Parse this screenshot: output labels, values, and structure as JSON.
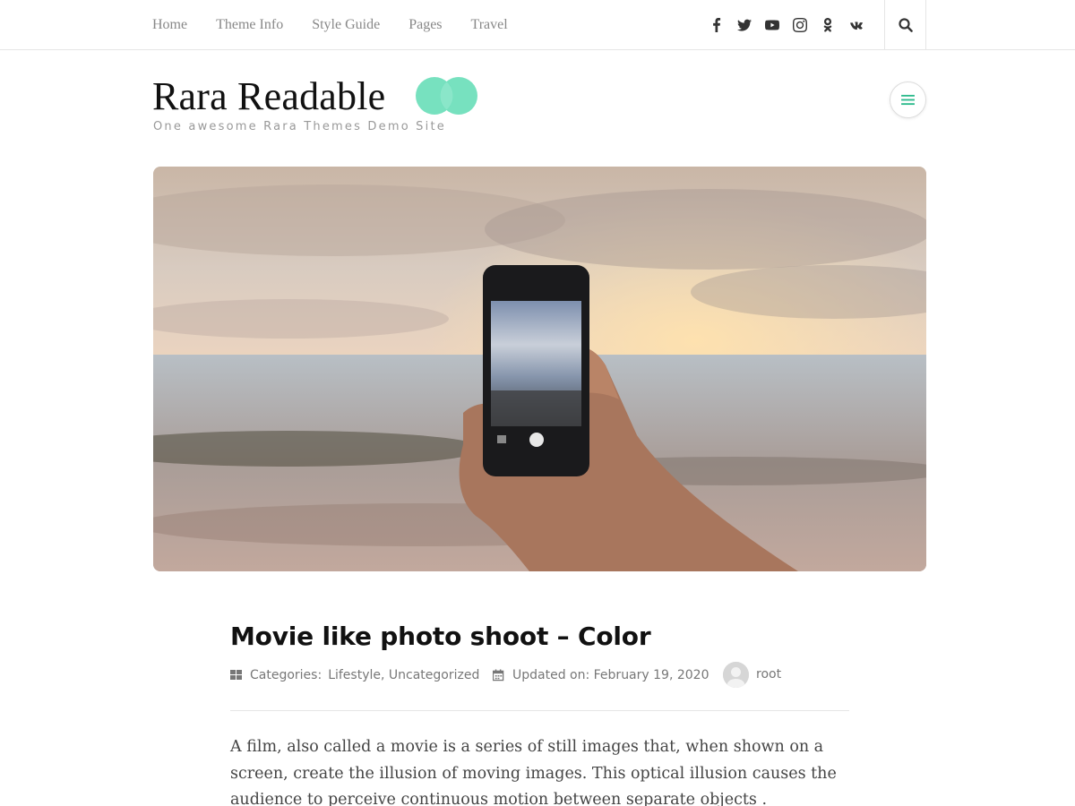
{
  "nav": {
    "items": [
      "Home",
      "Theme Info",
      "Style Guide",
      "Pages",
      "Travel"
    ]
  },
  "social": {
    "icons": [
      "facebook-icon",
      "twitter-icon",
      "youtube-icon",
      "instagram-icon",
      "odnoklassniki-icon",
      "vk-icon"
    ]
  },
  "header": {
    "site_title": "Rara Readable",
    "tagline": "One awesome Rara Themes Demo Site",
    "accent_color": "#5fdcb4"
  },
  "post": {
    "title": "Movie like photo shoot – Color",
    "categories_label": "Categories:",
    "categories": "Lifestyle, Uncategorized",
    "updated_label": "Updated on: February 19, 2020",
    "author": "root",
    "excerpt": "A film, also called a movie is a series of still images that, when shown on a screen, create the illusion of moving images. This optical illusion causes the audience to perceive continuous motion between separate objects ."
  }
}
